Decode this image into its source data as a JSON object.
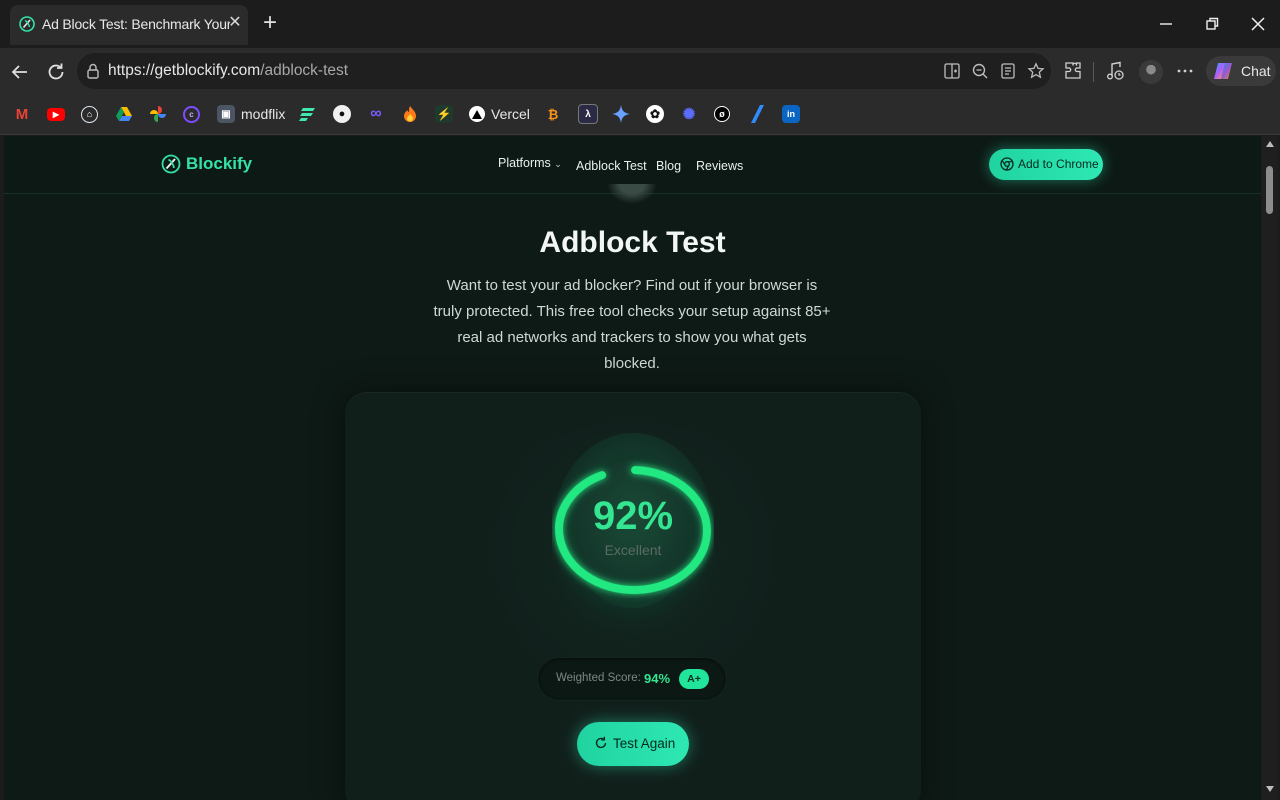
{
  "browser": {
    "tab_title": "Ad Block Test: Benchmark Your Ad",
    "url_host": "https://getblockify.com",
    "url_path": "/adblock-test",
    "chat_label": "Chat"
  },
  "bookmarks": [
    {
      "icon": "gmail-icon",
      "label": ""
    },
    {
      "icon": "youtube-icon",
      "label": ""
    },
    {
      "icon": "home-icon",
      "label": ""
    },
    {
      "icon": "google-drive-icon",
      "label": ""
    },
    {
      "icon": "pinwheel-icon",
      "label": ""
    },
    {
      "icon": "purple-app-icon",
      "label": ""
    },
    {
      "icon": "modflix-icon",
      "label": "modflix"
    },
    {
      "icon": "framer-icon",
      "label": ""
    },
    {
      "icon": "github-icon",
      "label": ""
    },
    {
      "icon": "infinity-icon",
      "label": ""
    },
    {
      "icon": "fire-icon",
      "label": ""
    },
    {
      "icon": "bolt-icon",
      "label": ""
    },
    {
      "icon": "vercel-icon",
      "label": "Vercel"
    },
    {
      "icon": "bitcoin-icon",
      "label": ""
    },
    {
      "icon": "lambda-icon",
      "label": ""
    },
    {
      "icon": "sparkle-icon",
      "label": ""
    },
    {
      "icon": "openai-icon",
      "label": ""
    },
    {
      "icon": "gear-swirl-icon",
      "label": ""
    },
    {
      "icon": "null-icon",
      "label": ""
    },
    {
      "icon": "slash-icon",
      "label": ""
    },
    {
      "icon": "linkedin-icon",
      "label": ""
    }
  ],
  "site": {
    "brand": "Blockify",
    "nav": {
      "platforms": "Platforms",
      "adblock_test": "Adblock Test",
      "blog": "Blog",
      "reviews": "Reviews"
    },
    "cta": "Add to Chrome"
  },
  "hero": {
    "title": "Adblock Test",
    "subtitle": "Want to test your ad blocker? Find out if your browser is truly protected. This free tool checks your setup against 85+ real ad networks and trackers to show you what gets blocked."
  },
  "result": {
    "score": "92%",
    "score_fraction": 0.92,
    "rating": "Excellent",
    "weighted_label": "Weighted Score:",
    "weighted_value": "94%",
    "grade": "A+",
    "test_again": "Test Again"
  },
  "colors": {
    "accent": "#2ee8b4",
    "score_green": "#34e592",
    "page_bg": "#0e1a16"
  }
}
